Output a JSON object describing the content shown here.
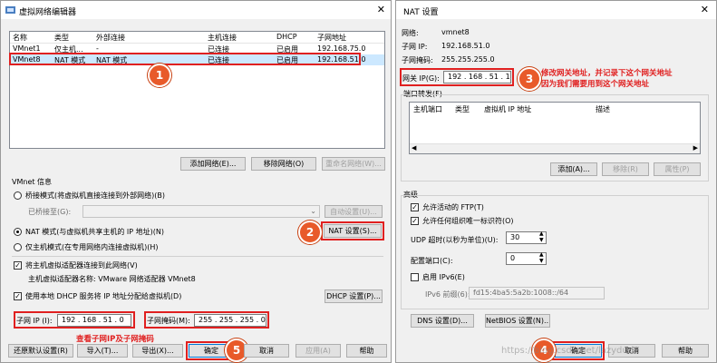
{
  "left": {
    "title": "虚拟网络编辑器",
    "table": {
      "headers": [
        "名称",
        "类型",
        "外部连接",
        "主机连接",
        "DHCP",
        "子网地址"
      ],
      "rows": [
        [
          "VMnet1",
          "仅主机...",
          "-",
          "已连接",
          "已启用",
          "192.168.75.0"
        ],
        [
          "VMnet8",
          "NAT 模式",
          "NAT 模式",
          "已连接",
          "已启用",
          "192.168.51.0"
        ]
      ]
    },
    "buttons": {
      "add_network": "添加网络(E)...",
      "remove_network": "移除网络(O)",
      "rename_network": "重命名网络(W)...",
      "auto_settings": "自动设置(U)...",
      "nat_settings": "NAT 设置(S)...",
      "dhcp_settings": "DHCP 设置(P)...",
      "restore_defaults": "还原默认设置(R)",
      "import": "导入(T)...",
      "export": "导出(X)...",
      "ok": "确定",
      "cancel": "取消",
      "apply": "应用(A)",
      "help": "帮助"
    },
    "vmnet_info": "VMnet 信息",
    "bridge_mode": "桥接模式(将虚拟机直接连接到外部网络)(B)",
    "bridged_to": "已桥接至(G):",
    "nat_mode": "NAT 模式(与虚拟机共享主机的 IP 地址)(N)",
    "host_only_mode": "仅主机模式(在专用网络内连接虚拟机)(H)",
    "connect_adapter": "将主机虚拟适配器连接到此网络(V)",
    "adapter_name": "主机虚拟适配器名称: VMware 网络适配器 VMnet8",
    "use_dhcp": "使用本地 DHCP 服务将 IP 地址分配给虚拟机(D)",
    "subnet_ip_label": "子网 IP (I):",
    "subnet_ip_value": "192 . 168 . 51 . 0",
    "subnet_mask_label": "子网掩码(M):",
    "subnet_mask_value": "255 . 255 . 255 . 0",
    "annotation_subnet": "查看子网IP及子网掩码"
  },
  "right": {
    "title": "NAT 设置",
    "network_label": "网络:",
    "network_value": "vmnet8",
    "subnet_ip_label": "子网 IP:",
    "subnet_ip_value": "192.168.51.0",
    "subnet_mask_label": "子网掩码:",
    "subnet_mask_value": "255.255.255.0",
    "gateway_label": "网关 IP(G):",
    "gateway_value": "192 . 168 . 51 . 1",
    "annotation_gateway_1": "修改网关地址，并记录下这个网关地址",
    "annotation_gateway_2": "因为我们需要用到这个网关地址",
    "port_forwarding": "端口转发(F)",
    "pf_headers": [
      "主机端口",
      "类型",
      "虚拟机 IP 地址",
      "描述"
    ],
    "add": "添加(A)...",
    "remove": "移除(R)",
    "properties": "属性(P)",
    "advanced": "高级",
    "allow_ftp": "允许活动的 FTP(T)",
    "allow_oui": "允许任何组织唯一标识符(O)",
    "udp_timeout_label": "UDP 超时(以秒为单位)(U):",
    "udp_timeout_value": "30",
    "config_port_label": "配置端口(C):",
    "config_port_value": "0",
    "enable_ipv6": "启用 IPv6(E)",
    "ipv6_prefix_label": "IPv6 前缀(6):",
    "ipv6_prefix_value": "fd15:4ba5:5a2b:1008::/64",
    "dns_settings": "DNS 设置(D)...",
    "netbios_settings": "NetBIOS 设置(N)...",
    "ok": "确定",
    "cancel": "取消",
    "help": "帮助"
  },
  "badges": [
    "1",
    "2",
    "3",
    "4",
    "5"
  ],
  "watermark": "https://blog.csdn.net/lazydude"
}
